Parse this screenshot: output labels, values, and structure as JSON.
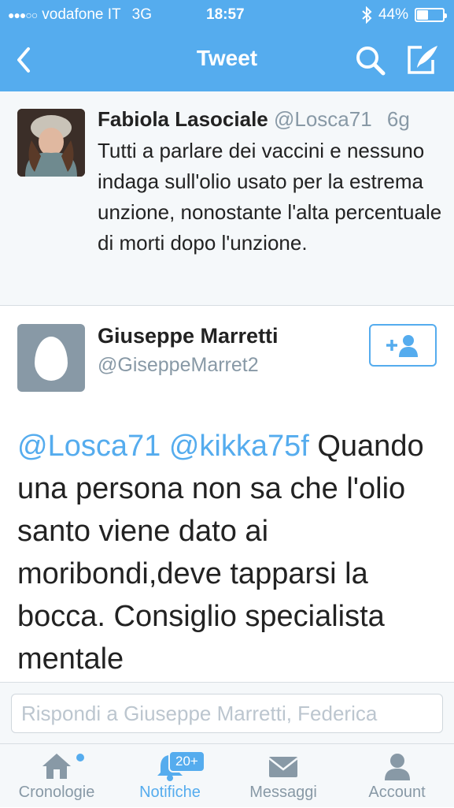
{
  "status_bar": {
    "carrier": "vodafone IT",
    "network": "3G",
    "time": "18:57",
    "battery": "44%",
    "battery_level": 0.44
  },
  "nav": {
    "title": "Tweet"
  },
  "parent_tweet": {
    "name": "Fabiola Lasociale",
    "handle": "@Losca71",
    "time": "6g",
    "text": "Tutti a parlare dei vaccini e nessuno indaga sull'olio usato per la estrema unzione, nonostante l'alta percentuale di morti dopo l'unzione."
  },
  "main_tweet": {
    "name": "Giuseppe Marretti",
    "handle": "@GiseppeMarret2",
    "mention_1": "@Losca71",
    "mention_2": "@kikka75f",
    "text": "Quando una persona non sa che l'olio santo viene dato ai moribondi,deve tapparsi la bocca. Consiglio specialista mentale"
  },
  "reply": {
    "placeholder": "Rispondi a Giuseppe Marretti, Federica"
  },
  "tabs": [
    {
      "label": "Cronologie",
      "icon": "home-icon"
    },
    {
      "label": "Notifiche",
      "icon": "bell-icon",
      "badge": "20+"
    },
    {
      "label": "Messaggi",
      "icon": "envelope-icon"
    },
    {
      "label": "Account",
      "icon": "person-icon"
    }
  ],
  "colors": {
    "brand": "#55acee",
    "text": "#222222",
    "muted": "#8899a6"
  }
}
